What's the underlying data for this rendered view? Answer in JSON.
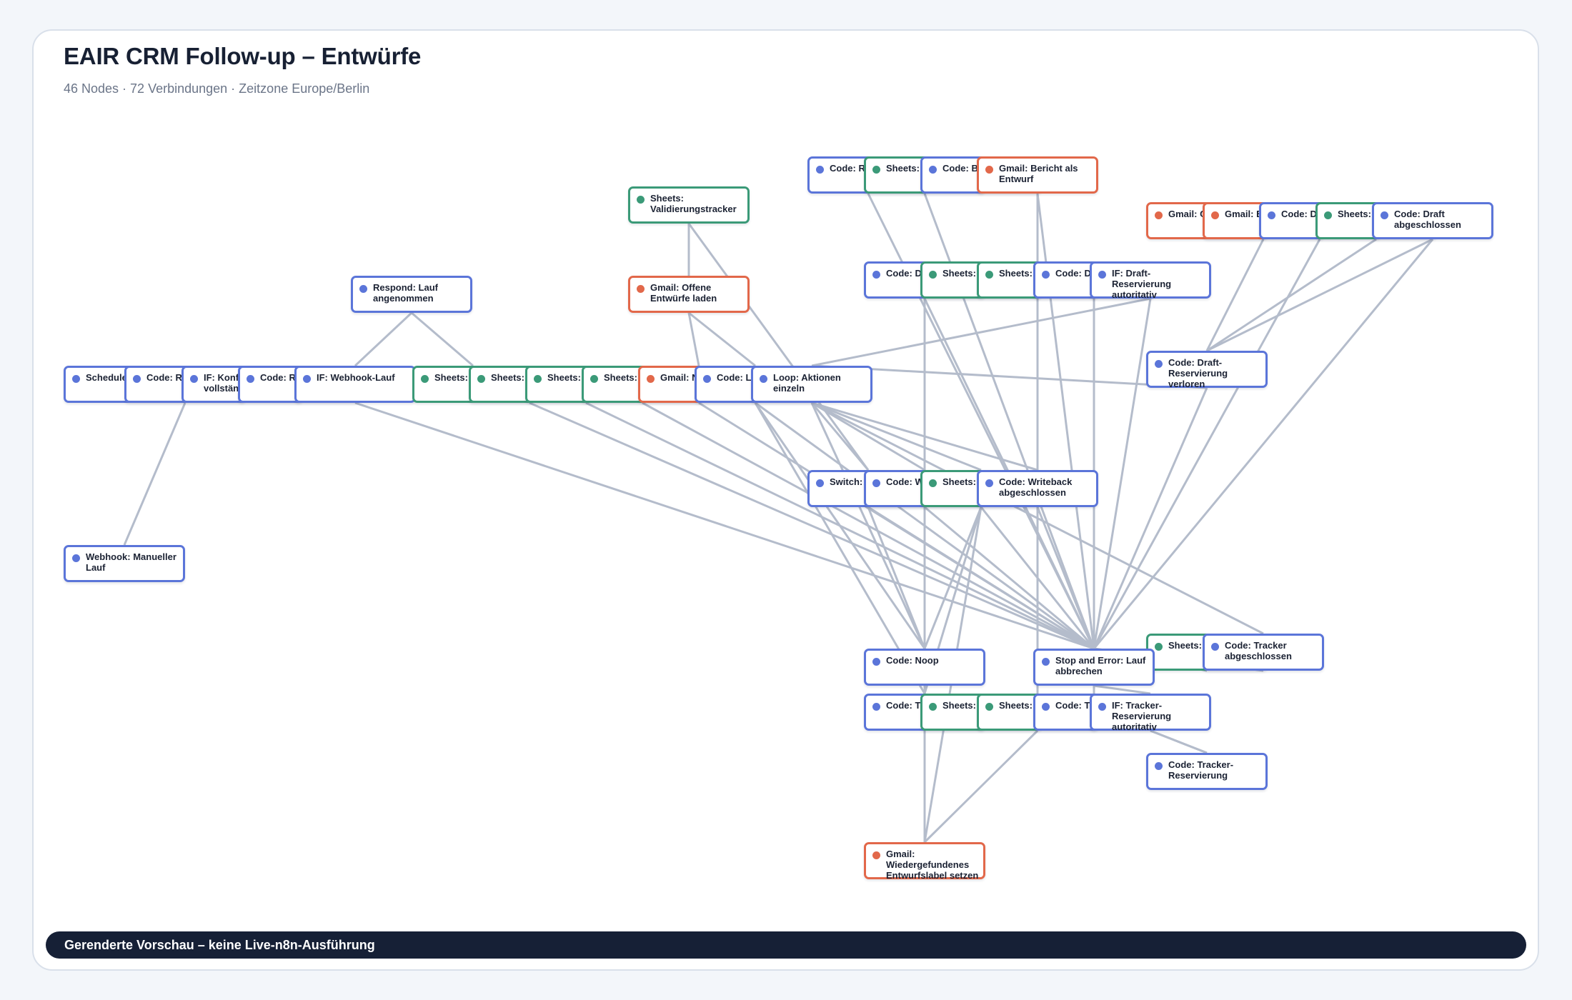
{
  "header": {
    "title": "EAIR CRM Follow-up – Entwürfe",
    "subtitle": "46 Nodes · 72 Verbindungen · Zeitzone Europe/Berlin"
  },
  "footer": {
    "text": "Gerenderte Vorschau – keine Live-n8n-Ausführung"
  },
  "colors": {
    "code": "#5b75d9",
    "sheets": "#3b9a78",
    "gmail": "#e2684a",
    "edge": "#b4bccb"
  },
  "nodes": [
    {
      "id": "schedule",
      "label": "Schedule Trigger",
      "kind": "code"
    },
    {
      "id": "code-runtime",
      "label": "Code: Runtime",
      "kind": "code"
    },
    {
      "id": "if-konfig",
      "label": "IF: Konfig vollständig",
      "kind": "code"
    },
    {
      "id": "code-r1",
      "label": "Code: R",
      "kind": "code"
    },
    {
      "id": "if-webhook",
      "label": "IF: Webhook-Lauf",
      "kind": "code"
    },
    {
      "id": "sheets-a",
      "label": "Sheets:",
      "kind": "sheets"
    },
    {
      "id": "sheets-b",
      "label": "Sheets:",
      "kind": "sheets"
    },
    {
      "id": "sheets-c",
      "label": "Sheets:",
      "kind": "sheets"
    },
    {
      "id": "sheets-d",
      "label": "Sheets:",
      "kind": "sheets"
    },
    {
      "id": "gmail-nachricht",
      "label": "Gmail: Nachricht",
      "kind": "gmail"
    },
    {
      "id": "code-l",
      "label": "Code: L",
      "kind": "code"
    },
    {
      "id": "loop",
      "label": "Loop: Aktionen einzeln",
      "kind": "code"
    },
    {
      "id": "webhook",
      "label": "Webhook: Manueller Lauf",
      "kind": "code"
    },
    {
      "id": "respond",
      "label": "Respond: Lauf angenommen",
      "kind": "code"
    },
    {
      "id": "sheets-valid",
      "label": "Sheets: Validierungstracker",
      "kind": "sheets"
    },
    {
      "id": "gmail-offene",
      "label": "Gmail: Offene Entwürfe laden",
      "kind": "gmail"
    },
    {
      "id": "code-r2",
      "label": "Code: R",
      "kind": "code"
    },
    {
      "id": "sheets-protoko1",
      "label": "Sheets: protoko",
      "kind": "sheets"
    },
    {
      "id": "code-b",
      "label": "Code: B",
      "kind": "code"
    },
    {
      "id": "gmail-bericht",
      "label": "Gmail: Bericht als Entwurf",
      "kind": "gmail"
    },
    {
      "id": "code-d1",
      "label": "Code: D",
      "kind": "code"
    },
    {
      "id": "sheets-reservi1",
      "label": "Sheets: reservi",
      "kind": "sheets"
    },
    {
      "id": "sheets-reservi2",
      "label": "Sheets: Reservi",
      "kind": "sheets"
    },
    {
      "id": "code-d-pruefen",
      "label": "Code: D prüfen",
      "kind": "code"
    },
    {
      "id": "if-draft-res",
      "label": "IF: Draft-Reservierung autoritativ",
      "kind": "code"
    },
    {
      "id": "gmail-entwurf",
      "label": "Gmail: C Entwurf",
      "kind": "gmail"
    },
    {
      "id": "gmail-eair",
      "label": "Gmail: EAIR-En",
      "kind": "gmail"
    },
    {
      "id": "code-d-vorbere",
      "label": "Code: D vorbere",
      "kind": "code"
    },
    {
      "id": "sheets-protoko2",
      "label": "Sheets: protoko",
      "kind": "sheets"
    },
    {
      "id": "code-draft-done",
      "label": "Code: Draft abgeschlossen",
      "kind": "code"
    },
    {
      "id": "code-draft-lost",
      "label": "Code: Draft-Reservierung verloren",
      "kind": "code"
    },
    {
      "id": "switch",
      "label": "Switch:",
      "kind": "code"
    },
    {
      "id": "code-w",
      "label": "Code: W vorbere",
      "kind": "code"
    },
    {
      "id": "sheets-writeba",
      "label": "Sheets: Writeba",
      "kind": "sheets"
    },
    {
      "id": "code-writeback",
      "label": "Code: Writeback abgeschlossen",
      "kind": "code"
    },
    {
      "id": "sheets-validier",
      "label": "Sheets: Validier",
      "kind": "sheets"
    },
    {
      "id": "code-tracker-done",
      "label": "Code: Tracker abgeschlossen",
      "kind": "code"
    },
    {
      "id": "code-noop",
      "label": "Code: Noop",
      "kind": "code"
    },
    {
      "id": "stop-error",
      "label": "Stop and Error: Lauf abbrechen",
      "kind": "code"
    },
    {
      "id": "code-t1",
      "label": "Code: T reservi",
      "kind": "code"
    },
    {
      "id": "sheets-reservi3",
      "label": "Sheets: reservi",
      "kind": "sheets"
    },
    {
      "id": "sheets-tracker",
      "label": "Sheets: Tracker",
      "kind": "sheets"
    },
    {
      "id": "code-t-pruefen",
      "label": "Code: T prüfen",
      "kind": "code"
    },
    {
      "id": "if-tracker-res",
      "label": "IF: Tracker-Reservierung autoritativ",
      "kind": "code"
    },
    {
      "id": "code-tracker-res",
      "label": "Code: Tracker-Reservierung",
      "kind": "code"
    },
    {
      "id": "gmail-wieder",
      "label": "Gmail: Wiedergefundenes Entwurfslabel setzen",
      "kind": "gmail"
    }
  ],
  "edges": [
    [
      "schedule",
      "code-runtime"
    ],
    [
      "code-runtime",
      "if-konfig"
    ],
    [
      "if-konfig",
      "code-r1"
    ],
    [
      "code-r1",
      "if-webhook"
    ],
    [
      "if-webhook",
      "sheets-a"
    ],
    [
      "sheets-a",
      "sheets-b"
    ],
    [
      "sheets-b",
      "sheets-c"
    ],
    [
      "sheets-c",
      "sheets-d"
    ],
    [
      "sheets-d",
      "gmail-nachricht"
    ],
    [
      "gmail-nachricht",
      "code-l"
    ],
    [
      "code-l",
      "loop"
    ],
    [
      "webhook",
      "code-runtime"
    ],
    [
      "if-webhook",
      "respond"
    ],
    [
      "respond",
      "sheets-a"
    ],
    [
      "sheets-valid",
      "gmail-offene"
    ],
    [
      "gmail-offene",
      "sheets-valid"
    ],
    [
      "gmail-offene",
      "gmail-nachricht"
    ],
    [
      "gmail-offene",
      "code-l"
    ],
    [
      "sheets-valid",
      "switch"
    ],
    [
      "loop",
      "switch"
    ],
    [
      "loop",
      "code-draft-lost"
    ],
    [
      "loop",
      "if-draft-res"
    ],
    [
      "loop",
      "code-w"
    ],
    [
      "loop",
      "sheets-writeba"
    ],
    [
      "loop",
      "code-writeback"
    ],
    [
      "loop",
      "code-tracker-done"
    ],
    [
      "loop",
      "code-noop"
    ],
    [
      "code-l",
      "stop-error"
    ],
    [
      "code-l",
      "code-noop"
    ],
    [
      "code-l",
      "code-t1"
    ],
    [
      "sheets-d",
      "stop-error"
    ],
    [
      "sheets-c",
      "stop-error"
    ],
    [
      "sheets-b",
      "stop-error"
    ],
    [
      "if-webhook",
      "stop-error"
    ],
    [
      "gmail-nachricht",
      "stop-error"
    ],
    [
      "code-r2",
      "stop-error"
    ],
    [
      "sheets-protoko1",
      "stop-error"
    ],
    [
      "gmail-bericht",
      "stop-error"
    ],
    [
      "gmail-bericht",
      "sheets-tracker"
    ],
    [
      "code-d1",
      "stop-error"
    ],
    [
      "code-d1",
      "code-t1"
    ],
    [
      "sheets-reservi2",
      "sheets-tracker"
    ],
    [
      "code-d-pruefen",
      "stop-error"
    ],
    [
      "if-draft-res",
      "stop-error"
    ],
    [
      "if-draft-res",
      "code-d-pruefen"
    ],
    [
      "code-d-vorbere",
      "stop-error"
    ],
    [
      "code-draft-done",
      "stop-error"
    ],
    [
      "code-draft-done",
      "code-draft-lost"
    ],
    [
      "sheets-protoko2",
      "code-draft-lost"
    ],
    [
      "gmail-eair",
      "code-draft-lost"
    ],
    [
      "code-draft-lost",
      "stop-error"
    ],
    [
      "switch",
      "stop-error"
    ],
    [
      "switch",
      "code-noop"
    ],
    [
      "code-w",
      "stop-error"
    ],
    [
      "sheets-writeba",
      "stop-error"
    ],
    [
      "sheets-writeba",
      "gmail-wieder"
    ],
    [
      "sheets-writeba",
      "code-noop"
    ],
    [
      "sheets-writeba",
      "code-t1"
    ],
    [
      "code-writeback",
      "stop-error"
    ],
    [
      "stop-error",
      "code-tracker-done"
    ],
    [
      "stop-error",
      "if-tracker-res"
    ],
    [
      "stop-error",
      "code-t-pruefen"
    ],
    [
      "if-tracker-res",
      "code-tracker-res"
    ],
    [
      "code-tracker-res",
      "if-tracker-res"
    ],
    [
      "sheets-validier",
      "stop-error"
    ],
    [
      "code-t1",
      "gmail-wieder"
    ],
    [
      "sheets-tracker",
      "gmail-wieder"
    ],
    [
      "gmail-wieder",
      "code-t1"
    ],
    [
      "code-noop",
      "code-t1"
    ],
    [
      "sheets-reservi3",
      "code-t1"
    ],
    [
      "code-t-pruefen",
      "if-tracker-res"
    ],
    [
      "sheets-tracker",
      "code-t-pruefen"
    ]
  ]
}
